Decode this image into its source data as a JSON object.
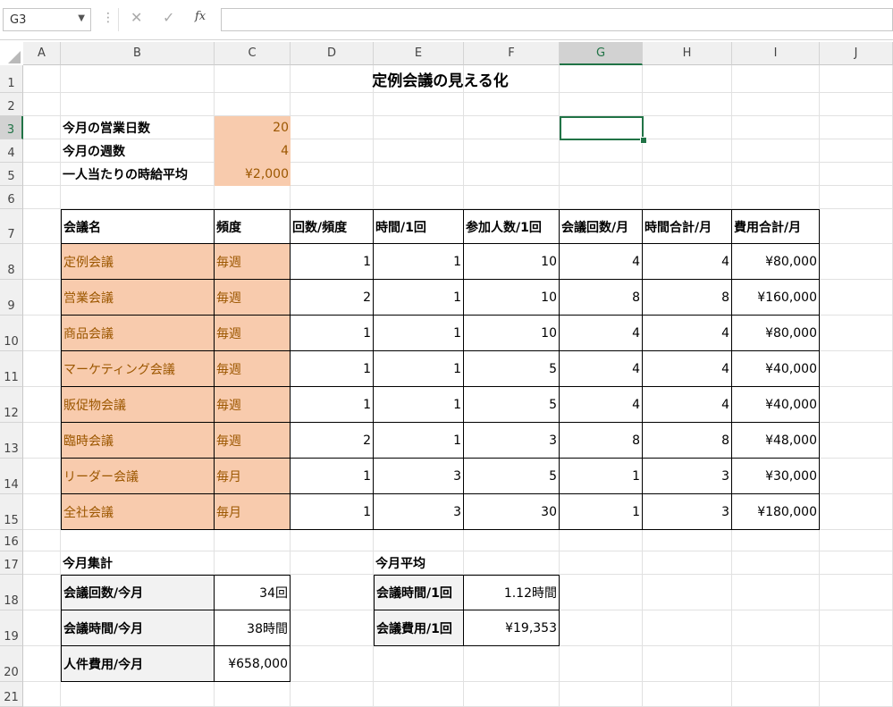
{
  "formula_bar": {
    "name_box": "G3",
    "cancel_icon": "✕",
    "enter_icon": "✓",
    "fx_label": "fx",
    "formula": ""
  },
  "columns": [
    "A",
    "B",
    "C",
    "D",
    "E",
    "F",
    "G",
    "H",
    "I",
    "J"
  ],
  "rows": [
    "1",
    "2",
    "3",
    "4",
    "5",
    "6",
    "7",
    "8",
    "9",
    "10",
    "11",
    "12",
    "13",
    "14",
    "15",
    "16",
    "17",
    "18",
    "19",
    "20",
    "21"
  ],
  "selected_cell": "G3",
  "sheet": {
    "title": "定例会議の見える化",
    "params": [
      {
        "label": "今月の営業日数",
        "value": "20"
      },
      {
        "label": "今月の週数",
        "value": "4"
      },
      {
        "label": "一人当たりの時給平均",
        "value": "¥2,000"
      }
    ],
    "table": {
      "headers": [
        "会議名",
        "頻度",
        "回数/頻度",
        "時間/1回",
        "参加人数/1回",
        "会議回数/月",
        "時間合計/月",
        "費用合計/月"
      ],
      "rows": [
        [
          "定例会議",
          "毎週",
          "1",
          "1",
          "10",
          "4",
          "4",
          "¥80,000"
        ],
        [
          "営業会議",
          "毎週",
          "2",
          "1",
          "10",
          "8",
          "8",
          "¥160,000"
        ],
        [
          "商品会議",
          "毎週",
          "1",
          "1",
          "10",
          "4",
          "4",
          "¥80,000"
        ],
        [
          "マーケティング会議",
          "毎週",
          "1",
          "1",
          "5",
          "4",
          "4",
          "¥40,000"
        ],
        [
          "販促物会議",
          "毎週",
          "1",
          "1",
          "5",
          "4",
          "4",
          "¥40,000"
        ],
        [
          "臨時会議",
          "毎週",
          "2",
          "1",
          "3",
          "8",
          "8",
          "¥48,000"
        ],
        [
          "リーダー会議",
          "毎月",
          "1",
          "3",
          "5",
          "1",
          "3",
          "¥30,000"
        ],
        [
          "全社会議",
          "毎月",
          "1",
          "3",
          "30",
          "1",
          "3",
          "¥180,000"
        ]
      ]
    },
    "summary": {
      "title": "今月集計",
      "items": [
        {
          "label": "会議回数/今月",
          "value": "34回"
        },
        {
          "label": "会議時間/今月",
          "value": "38時間"
        },
        {
          "label": "人件費用/今月",
          "value": "¥658,000"
        }
      ]
    },
    "average": {
      "title": "今月平均",
      "items": [
        {
          "label": "会議時間/1回",
          "value": "1.12時間"
        },
        {
          "label": "会議費用/1回",
          "value": "¥19,353"
        }
      ]
    }
  },
  "colors": {
    "input_fill": "#f8cbad",
    "input_text": "#9c5700",
    "label_fill": "#f2f2f2",
    "selection": "#217346"
  }
}
